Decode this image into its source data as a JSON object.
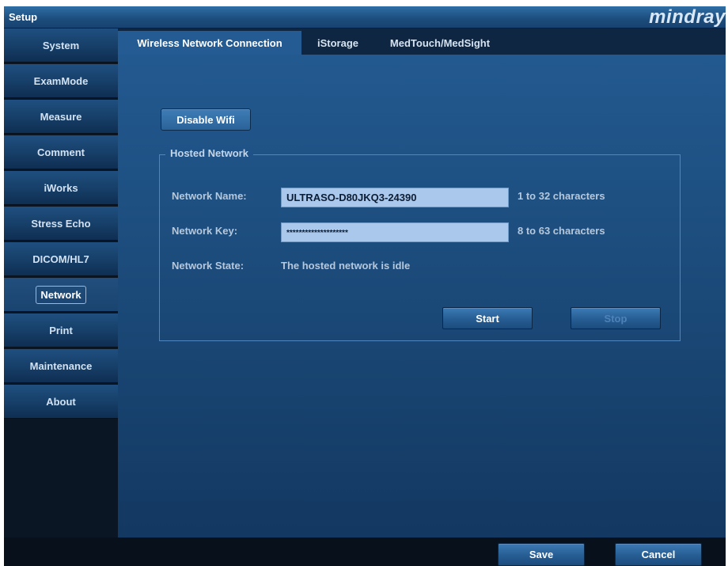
{
  "window": {
    "title": "Setup",
    "brand": "mindray"
  },
  "sidebar": {
    "items": [
      {
        "label": "System"
      },
      {
        "label": "ExamMode"
      },
      {
        "label": "Measure"
      },
      {
        "label": "Comment"
      },
      {
        "label": "iWorks"
      },
      {
        "label": "Stress Echo"
      },
      {
        "label": "DICOM/HL7"
      },
      {
        "label": "Network",
        "active": true
      },
      {
        "label": "Print"
      },
      {
        "label": "Maintenance"
      },
      {
        "label": "About"
      }
    ]
  },
  "tabs": [
    {
      "label": "Wireless Network Connection",
      "active": true
    },
    {
      "label": "iStorage"
    },
    {
      "label": "MedTouch/MedSight"
    }
  ],
  "wifi": {
    "disable_label": "Disable Wifi"
  },
  "hosted_network": {
    "legend": "Hosted Network",
    "name_label": "Network Name:",
    "name_value": "ULTRASO-D80JKQ3-24390",
    "name_hint": "1 to 32 characters",
    "key_label": "Network Key:",
    "key_value": "********************",
    "key_hint": "8 to 63 characters",
    "state_label": "Network State:",
    "state_value": "The hosted network is idle",
    "start_label": "Start",
    "stop_label": "Stop",
    "stop_enabled": false
  },
  "footer": {
    "save_label": "Save",
    "cancel_label": "Cancel"
  },
  "colors": {
    "titlebar": "#1c4c7c",
    "panel": "#1c4c7c",
    "sidebar_item": "#163e67",
    "field": "#a9c8ec",
    "disabled_text": "#4d82b8"
  }
}
